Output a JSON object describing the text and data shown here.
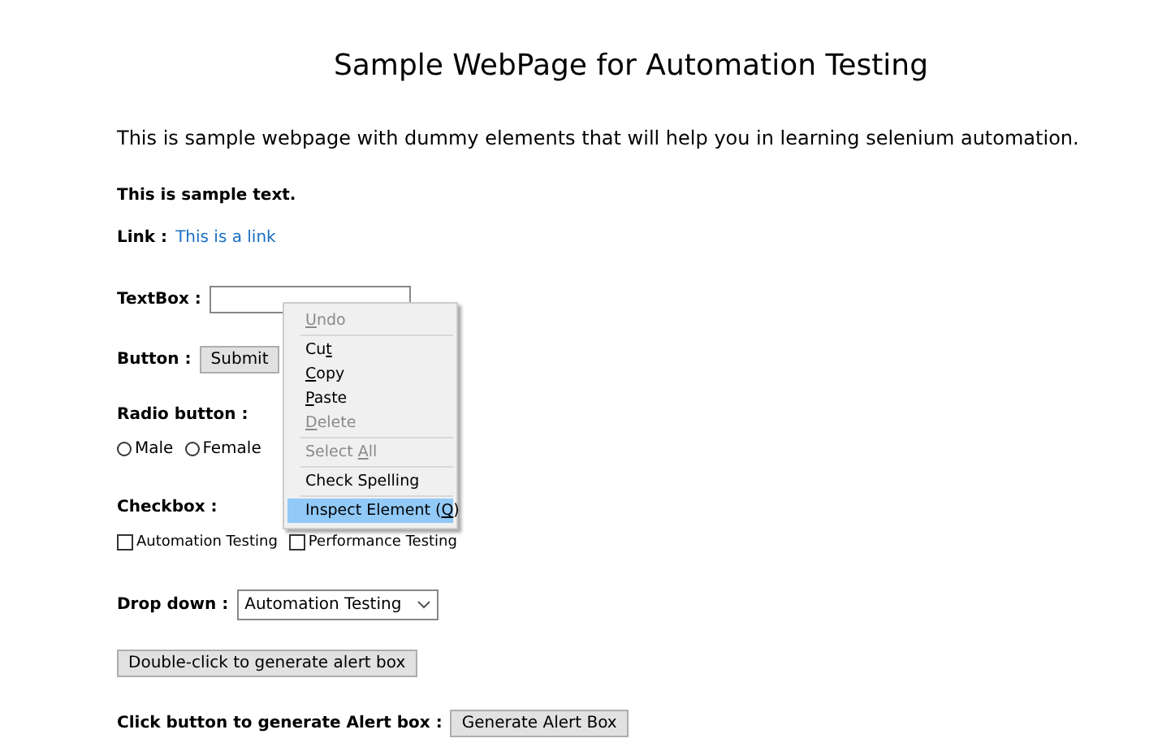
{
  "title": "Sample WebPage for Automation Testing",
  "intro": "This is sample webpage with dummy elements that will help you in learning selenium automation.",
  "sample_text": "This is sample text.",
  "link": {
    "label": "Link :",
    "text": "This is a link"
  },
  "textbox": {
    "label": "TextBox :"
  },
  "button": {
    "label": "Button :",
    "text": "Submit"
  },
  "radio": {
    "label": "Radio button :",
    "options": [
      {
        "text": "Male",
        "selected": false
      },
      {
        "text": "Female",
        "selected": false
      }
    ]
  },
  "checkbox": {
    "label": "Checkbox :",
    "options": [
      {
        "text": "Automation Testing",
        "checked": false
      },
      {
        "text": "Performance Testing",
        "checked": false
      }
    ]
  },
  "dropdown": {
    "label": "Drop down :",
    "value": "Automation Testing"
  },
  "double_click_button": "Double-click to generate alert box",
  "alert": {
    "label": "Click button to generate Alert box :",
    "button": "Generate Alert Box"
  },
  "context_menu": [
    {
      "kind": "item",
      "key": "U",
      "post": "ndo",
      "disabled": true,
      "selected": false
    },
    {
      "kind": "separator"
    },
    {
      "kind": "item",
      "pre": "Cu",
      "key": "t",
      "disabled": false,
      "selected": false
    },
    {
      "kind": "item",
      "key": "C",
      "post": "opy",
      "disabled": false,
      "selected": false
    },
    {
      "kind": "item",
      "key": "P",
      "post": "aste",
      "disabled": false,
      "selected": false
    },
    {
      "kind": "item",
      "key": "D",
      "post": "elete",
      "disabled": true,
      "selected": false
    },
    {
      "kind": "separator"
    },
    {
      "kind": "item",
      "pre": "Select ",
      "key": "A",
      "post": "ll",
      "disabled": true,
      "selected": false
    },
    {
      "kind": "separator"
    },
    {
      "kind": "item",
      "pre": "Check Spelling",
      "disabled": false,
      "selected": false
    },
    {
      "kind": "separator"
    },
    {
      "kind": "item",
      "pre": "Inspect Element (",
      "key": "Q",
      "post": ")",
      "disabled": false,
      "selected": true
    }
  ]
}
